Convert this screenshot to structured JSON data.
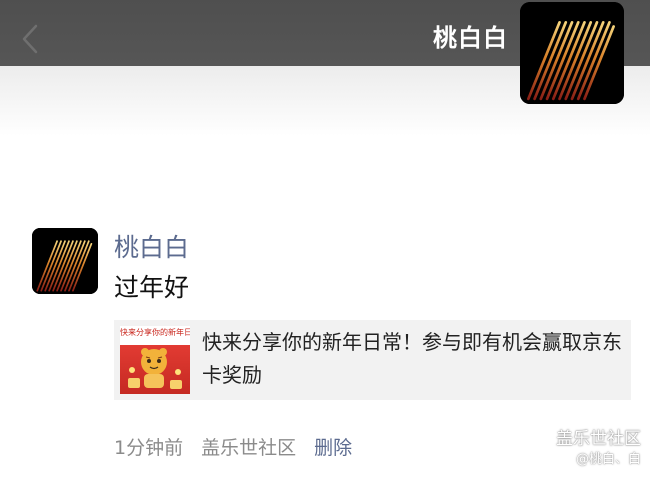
{
  "header": {
    "back_icon": "chevron-left-icon",
    "title": "桃白白",
    "camera_icon": "camera-icon",
    "bg_color": "#545454"
  },
  "profile": {
    "avatar": "gold-stripes-logo"
  },
  "post": {
    "author": "桃白白",
    "text": "过年好",
    "share_card": {
      "thumbnail_caption": "快来分享你的新年日常",
      "title": "快来分享你的新年日常！参与即有机会赢取京东卡奖励"
    },
    "time": "1分钟前",
    "source": "盖乐世社区",
    "delete_label": "删除",
    "name_color": "#5c6b8f"
  },
  "watermark": {
    "main": "盖乐世社区",
    "sub": "@桃白、白"
  }
}
